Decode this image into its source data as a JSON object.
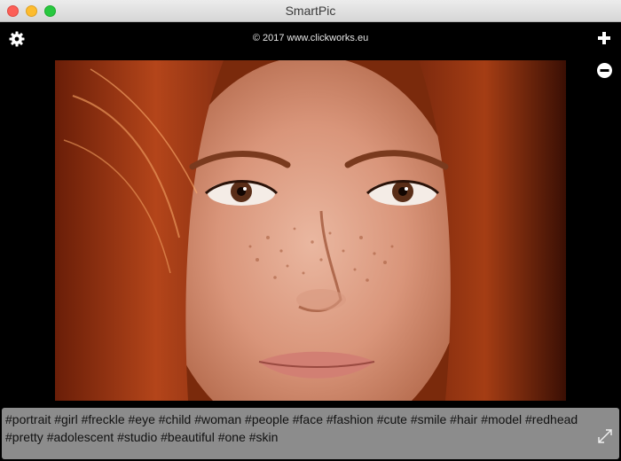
{
  "window": {
    "title": "SmartPic"
  },
  "toolbar": {
    "copyright": "© 2017 www.clickworks.eu",
    "settings_icon": "gear-icon",
    "add_icon": "plus-icon",
    "remove_icon": "minus-circle-icon"
  },
  "photo": {
    "subject": "close-up portrait of red-haired girl with freckles"
  },
  "tags": {
    "text": "#portrait #girl #freckle #eye #child #woman #people #face #fashion #cute #smile #hair #model #redhead #pretty #adolescent #studio #beautiful #one #skin",
    "expand_icon": "expand-arrows-icon"
  },
  "colors": {
    "titlebar": "#e0e0e0",
    "background": "#000000",
    "tags_panel": "#8c8c8c",
    "close": "#fc5f57",
    "minimize": "#fdbc2e",
    "maximize": "#28c840"
  }
}
